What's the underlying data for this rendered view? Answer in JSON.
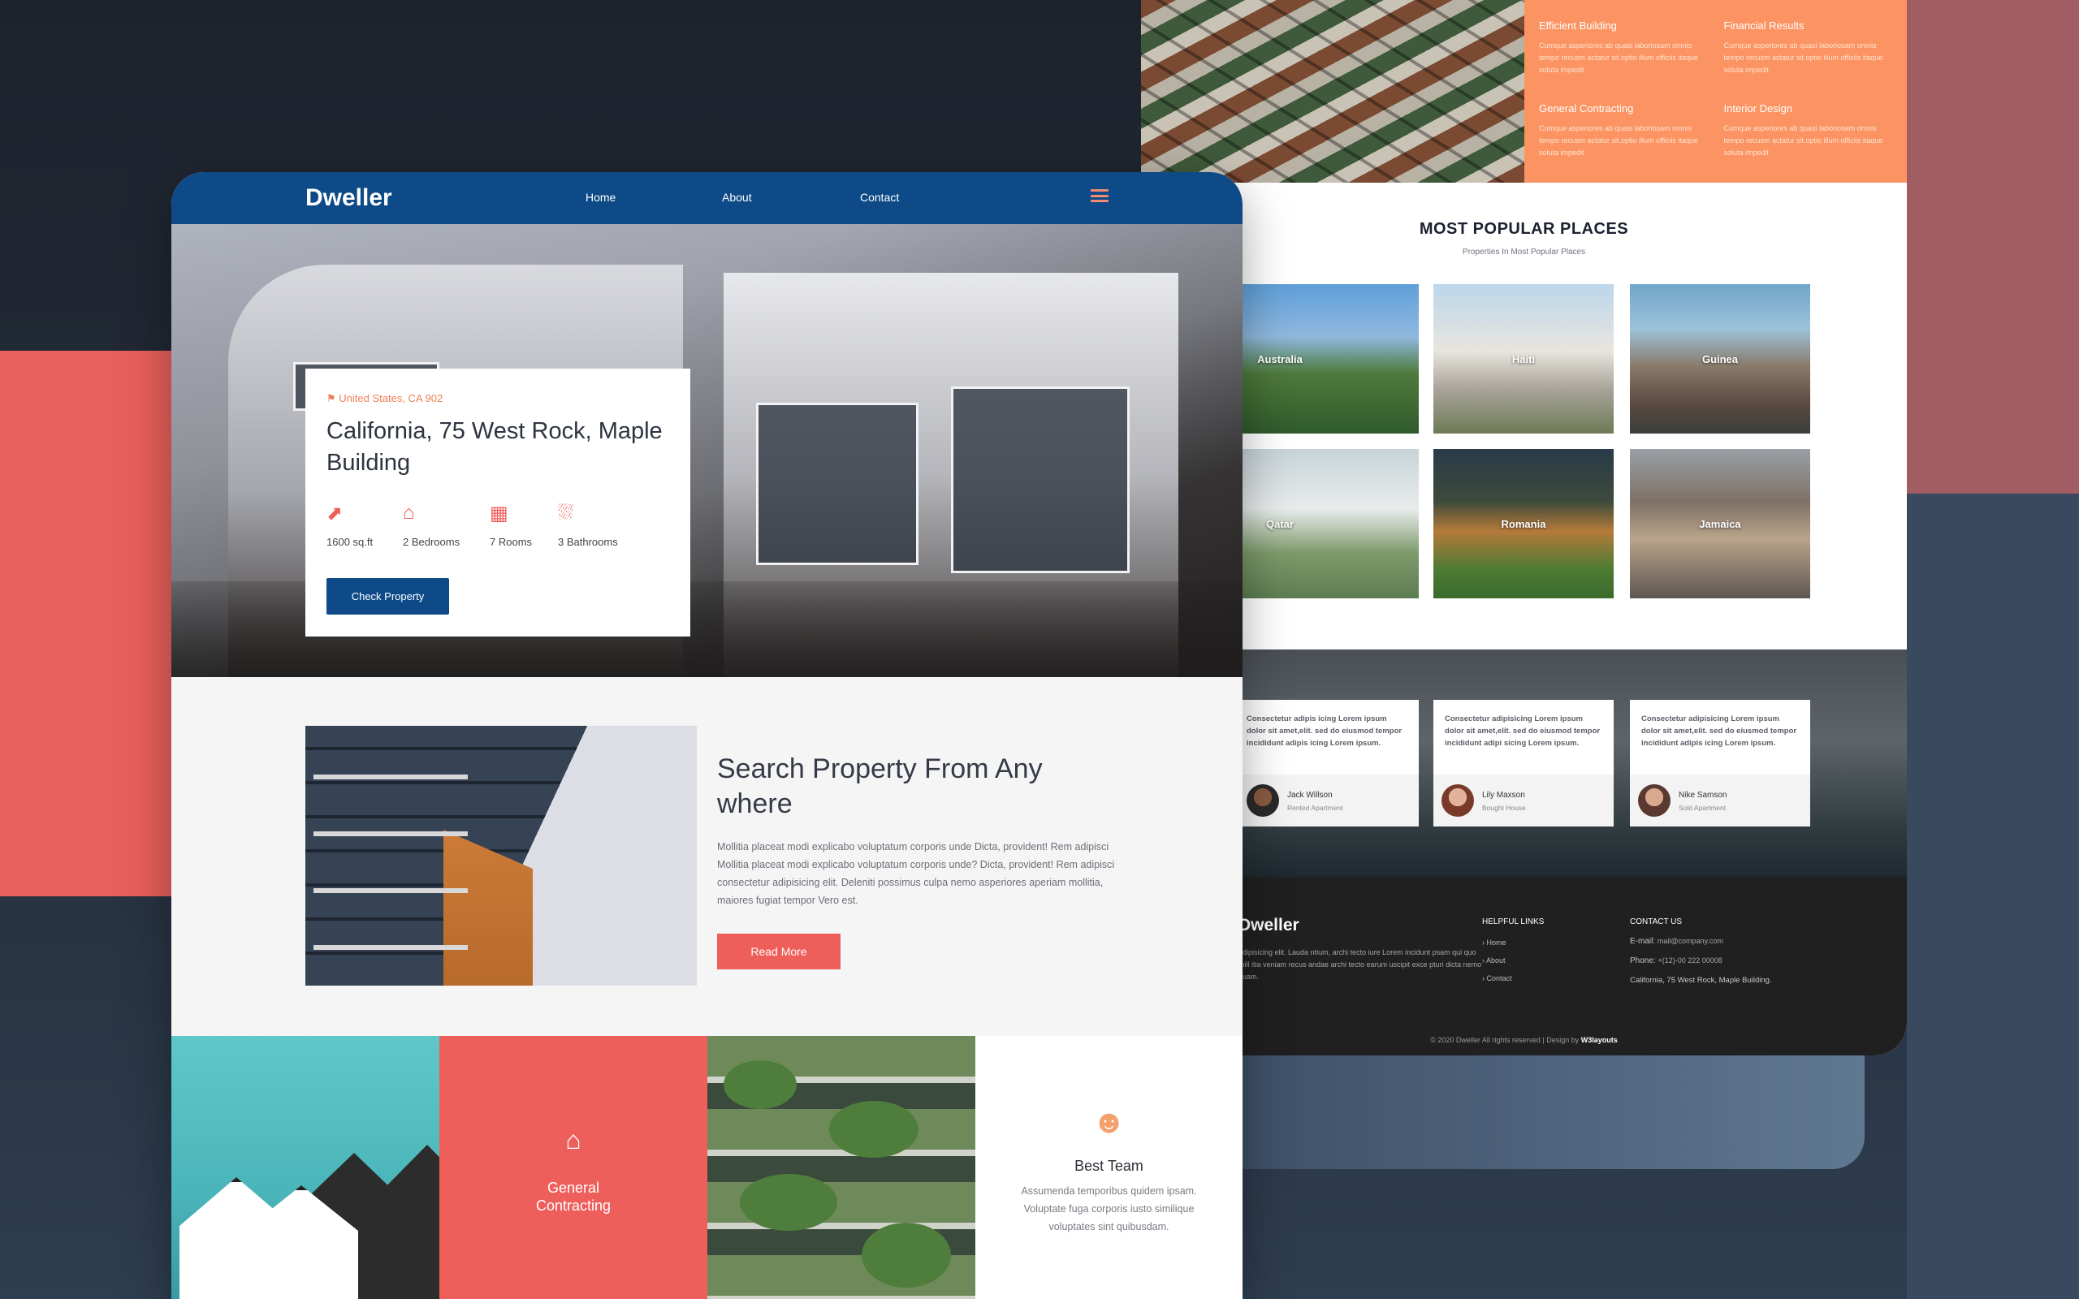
{
  "back_page": {
    "features": [
      {
        "title": "Efficient Building",
        "text": "Cumque asperiores ab quasi laboriosam omnis tempo recusm actatur sit.optio illum officiis itaque soluta impedit"
      },
      {
        "title": "Financial Results",
        "text": "Cumque asperiores ab quasi laboriosam omnis tempo recusm actatur sit.optio illum officiis itaque soluta impedit"
      },
      {
        "title": "General Contracting",
        "text": "Cumque asperiores ab quasi laboriosam omnis tempo recusm actatur sit.optio illum officiis itaque soluta impedit"
      },
      {
        "title": "Interior Design",
        "text": "Cumque asperiores ab quasi laboriosam omnis tempo recusm actatur sit.optio illum officiis itaque soluta impedit"
      }
    ],
    "popular": {
      "title": "MOST POPULAR PLACES",
      "subtitle": "Properties In Most Popular Places",
      "places": [
        "Australia",
        "Haiti",
        "Guinea",
        "Qatar",
        "Romania",
        "Jamaica"
      ]
    },
    "testimonials": [
      {
        "quote": "Consectetur adipis icing Lorem ipsum dolor sit amet,elit. sed do eiusmod tempor incididunt adipis icing Lorem ipsum.",
        "name": "Jack Willson",
        "role": "Rented Apartment"
      },
      {
        "quote": "Consectetur adipisicing Lorem ipsum dolor sit amet,elit. sed do eiusmod tempor incididunt adipi sicing Lorem ipsum.",
        "name": "Lily Maxson",
        "role": "Bought House"
      },
      {
        "quote": "Consectetur adipisicing Lorem ipsum dolor sit amet,elit. sed do eiusmod tempor incididunt adipis icing Lorem ipsum.",
        "name": "Nike Samson",
        "role": "Sold Apartment"
      }
    ],
    "footer": {
      "logo": "Dweller",
      "description": "adipisicing elit. Lauda ntium, archi tecto iure Lorem incidunt psam qui quo mill itia veniam recus andae archi tecto earum uscipit exce pturi dicta nemo quam.",
      "links_heading": "HELPFUL LINKS",
      "links": [
        "Home",
        "About",
        "Contact"
      ],
      "contact_heading": "CONTACT US",
      "email_label": "E-mail:",
      "email": "mail@company.com",
      "phone_label": "Phone:",
      "phone": "+(12)-00 222 00008",
      "address": "California, 75 West Rock, Maple Building.",
      "copyright": "© 2020 Dweller All rights reserved | Design by",
      "designer": "W3layouts"
    }
  },
  "front_page": {
    "nav": {
      "logo": "Dweller",
      "links": [
        "Home",
        "About",
        "Contact"
      ]
    },
    "property": {
      "location": "United States, CA 902",
      "title": "California, 75 West Rock, Maple Building",
      "stats": [
        {
          "icon": "share-icon",
          "label": "1600 sq.ft"
        },
        {
          "icon": "home-icon",
          "label": "2 Bedrooms"
        },
        {
          "icon": "building-icon",
          "label": "7 Rooms"
        },
        {
          "icon": "shower-icon",
          "label": "3 Bathrooms"
        }
      ],
      "button": "Check Property"
    },
    "search": {
      "title": "Search Property From Any where",
      "description": "Mollitia placeat modi explicabo voluptatum corporis unde Dicta, provident! Rem adipisci Mollitia placeat modi explicabo voluptatum corporis unde? Dicta, provident! Rem adipisci consectetur adipisicing elit. Deleniti possimus culpa nemo asperiores aperiam mollitia, maiores fugiat tempor Vero est.",
      "button": "Read More"
    },
    "services": {
      "contracting_label": "General Contracting",
      "team_title": "Best Team",
      "team_text": "Assumenda temporibus quidem ipsam. Voluptate fuga corporis iusto similique voluptates sint quibusdam."
    }
  },
  "colors": {
    "nav_blue": "#0d4a87",
    "accent_red": "#ee5f5b",
    "accent_orange": "#fb9462",
    "footer_dark": "#202020"
  }
}
